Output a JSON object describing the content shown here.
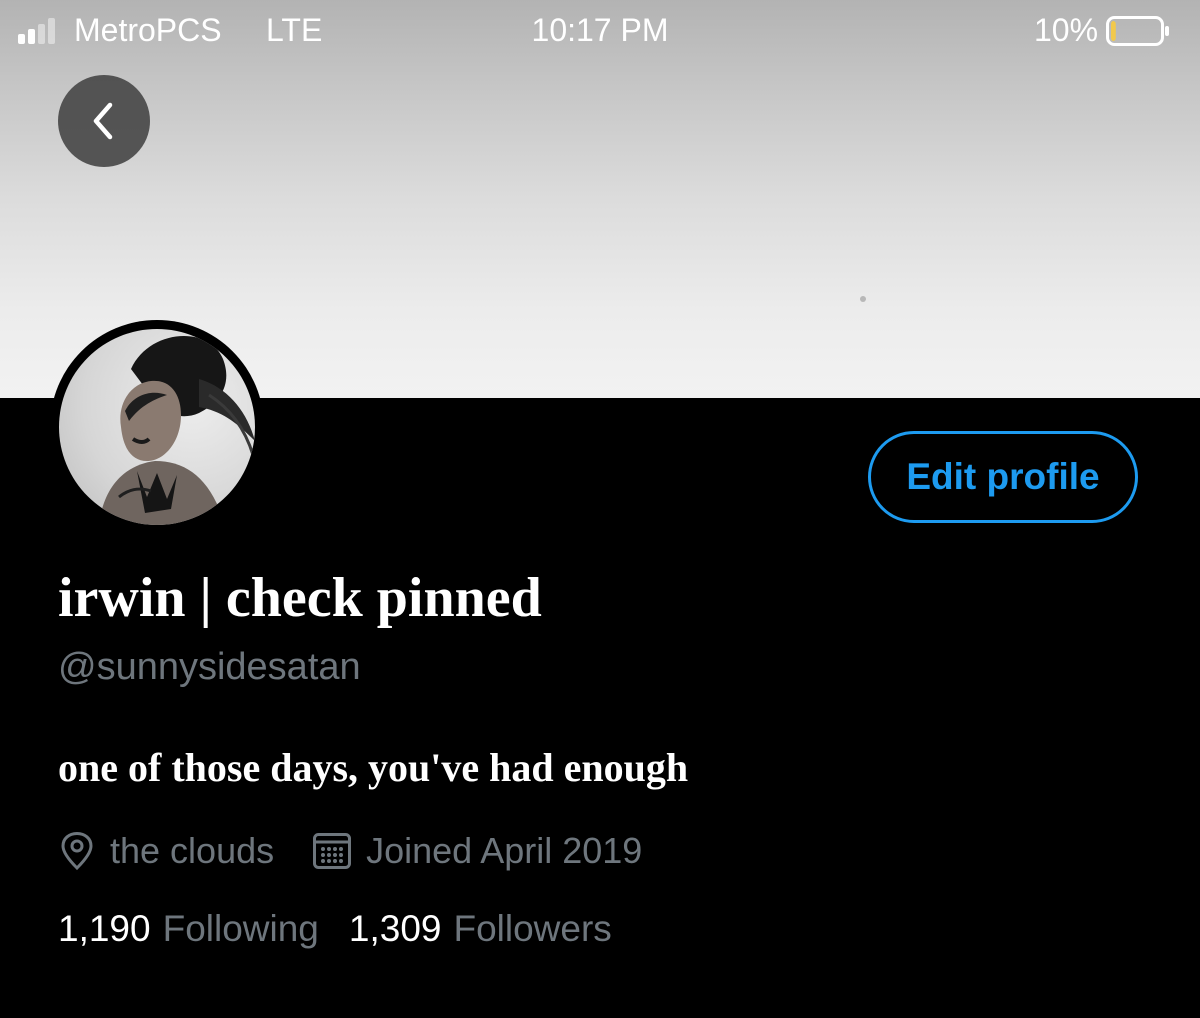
{
  "status_bar": {
    "carrier": "MetroPCS",
    "network": "LTE",
    "time": "10:17 PM",
    "battery_percent": "10%",
    "battery_level": 0.1,
    "battery_color": "#f2c94c"
  },
  "icons": {
    "back": "chevron-left-icon",
    "location": "location-pin-icon",
    "calendar": "calendar-icon"
  },
  "profile": {
    "display_name": "irwin | check pinned",
    "handle": "@sunnysidesatan",
    "bio": "one of those days, you've had enough",
    "location": "the clouds",
    "joined": "Joined April 2019",
    "following_count": "1,190",
    "following_label": "Following",
    "followers_count": "1,309",
    "followers_label": "Followers"
  },
  "actions": {
    "edit_profile": "Edit profile"
  },
  "colors": {
    "accent": "#1d9bf0",
    "background": "#000000",
    "secondary_text": "#6e767d"
  }
}
